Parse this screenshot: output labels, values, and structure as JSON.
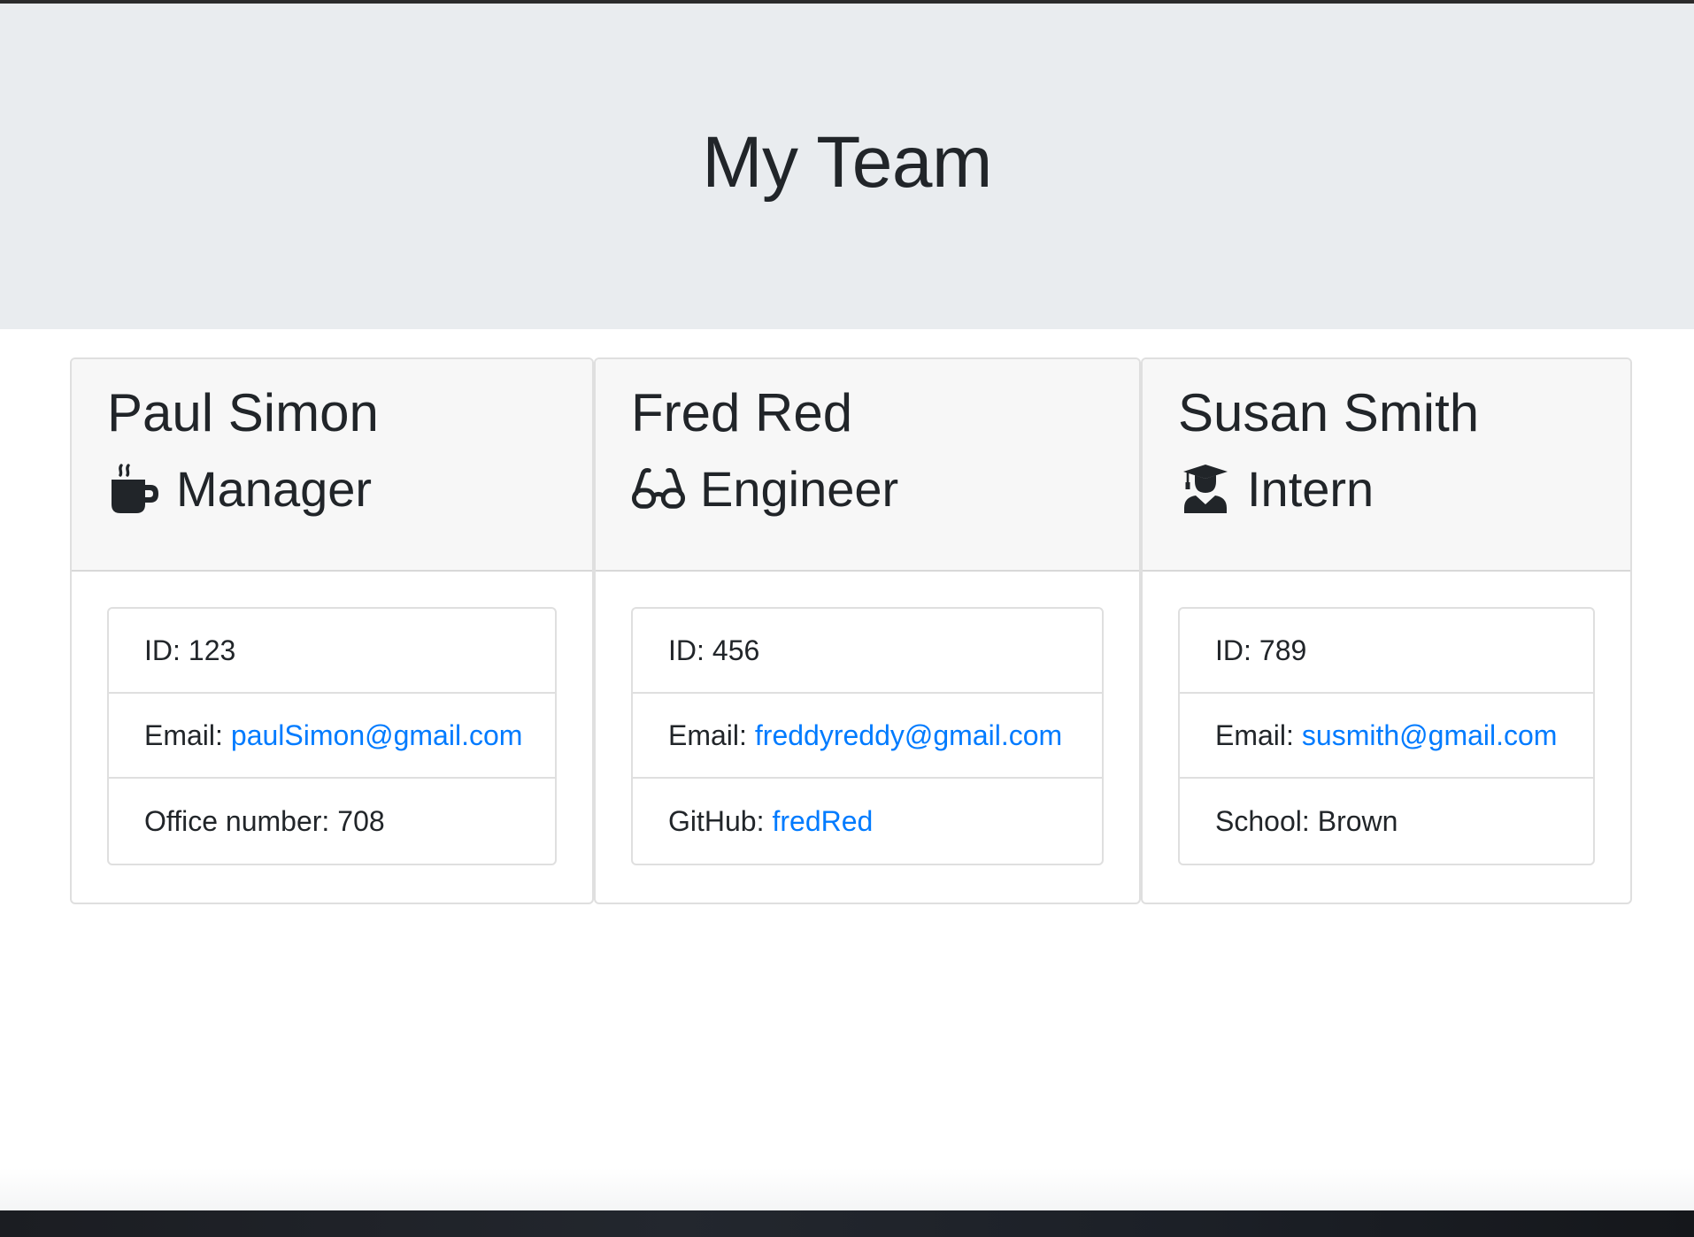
{
  "header": {
    "title": "My Team"
  },
  "team": [
    {
      "name": "Paul Simon",
      "role": "Manager",
      "role_icon": "coffee-mug-icon",
      "id_label": "ID:",
      "id_value": "123",
      "email_label": "Email:",
      "email": "paulSimon@gmail.com",
      "extra_label": "Office number:",
      "extra_value": "708"
    },
    {
      "name": "Fred Red",
      "role": "Engineer",
      "role_icon": "glasses-icon",
      "id_label": "ID:",
      "id_value": "456",
      "email_label": "Email:",
      "email": "freddyreddy@gmail.com",
      "extra_label": "GitHub:",
      "extra_value": "fredRed"
    },
    {
      "name": "Susan Smith",
      "role": "Intern",
      "role_icon": "graduate-icon",
      "id_label": "ID:",
      "id_value": "789",
      "email_label": "Email:",
      "email": "susmith@gmail.com",
      "extra_label": "School:",
      "extra_value": "Brown"
    }
  ],
  "colors": {
    "jumbotron_bg": "#e9ecef",
    "card_header_bg": "#f7f7f7",
    "link": "#007bff",
    "text": "#212529"
  }
}
